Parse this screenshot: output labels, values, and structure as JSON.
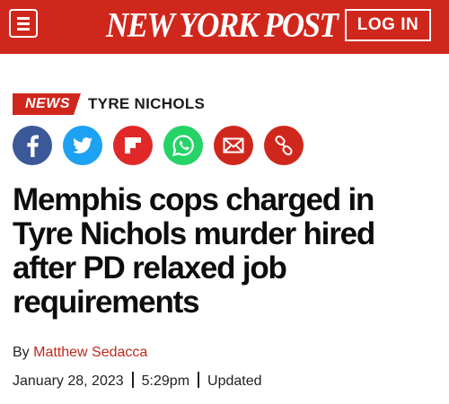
{
  "header": {
    "logo_text": "NEW YORK POST",
    "login_label": "LOG IN",
    "brand_color": "#d0271d"
  },
  "section": {
    "tag": "NEWS",
    "topic": "TYRE NICHOLS"
  },
  "share": {
    "buttons": [
      {
        "icon": "facebook-icon",
        "color": "#3b5998"
      },
      {
        "icon": "twitter-icon",
        "color": "#1da1f2"
      },
      {
        "icon": "flipboard-icon",
        "color": "#e12828"
      },
      {
        "icon": "whatsapp-icon",
        "color": "#25d366"
      },
      {
        "icon": "email-icon",
        "color": "#d0271d"
      },
      {
        "icon": "link-icon",
        "color": "#d0271d"
      }
    ]
  },
  "article": {
    "headline_lines": [
      "Memphis cops charged in",
      "Tyre Nichols murder hired",
      "after PD relaxed job",
      "requirements"
    ],
    "byline_prefix": "By",
    "author": "Matthew Sedacca",
    "date": "January 28, 2023",
    "time": "5:29pm",
    "updated_label": "Updated"
  }
}
